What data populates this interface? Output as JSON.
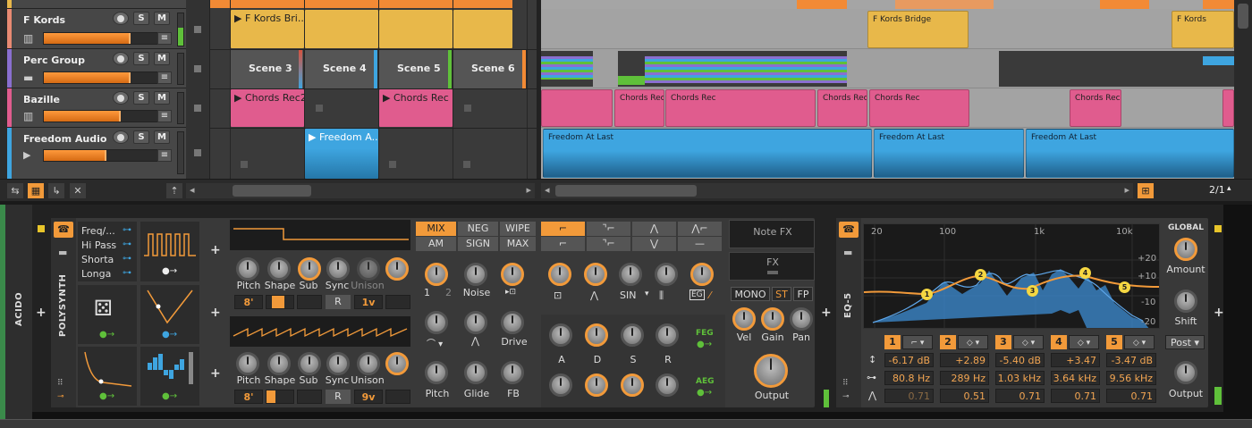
{
  "tracks": [
    {
      "name": "F Kords",
      "color": "#e88a72",
      "icon": "piano-icon"
    },
    {
      "name": "Perc Group",
      "color": "#8a6fd0",
      "icon": "folder-icon"
    },
    {
      "name": "Bazille",
      "color": "#e05c8e",
      "icon": "piano-icon"
    },
    {
      "name": "Freedom Audio",
      "color": "#3ea5e0",
      "icon": "play-icon"
    }
  ],
  "track_buttons": {
    "s": "S",
    "m": "M"
  },
  "launcher_clips": {
    "fkords": [
      "F Kords Bri..."
    ],
    "scenes": [
      "Scene 3",
      "Scene 4",
      "Scene 5",
      "Scene 6"
    ],
    "bazille": [
      "Chords Rec2",
      "Chords Rec"
    ],
    "freedom": [
      "Freedom A..."
    ]
  },
  "arranger_clips": {
    "fkords": [
      "F Kords Bridge",
      "F Kords"
    ],
    "bazille": [
      "Chords Rec",
      "Chords Rec",
      "Chords Rec",
      "Chords Rec",
      "Chords Rec"
    ],
    "freedom": [
      "Freedom At Last",
      "Freedom At Last",
      "Freedom At Last"
    ]
  },
  "arranger_zoom": "2/1",
  "device_strip": {
    "track_label": "ACIDO"
  },
  "polysynth": {
    "title": "POLYSYNTH",
    "mod_list": [
      "Freq/...",
      "Hi Pass",
      "Shorta",
      "Longa"
    ],
    "osc1_knobs": [
      "Pitch",
      "Shape",
      "Sub",
      "Sync",
      "Unison"
    ],
    "osc1_values": [
      "8'",
      "R",
      "1v"
    ],
    "osc2_knobs": [
      "Pitch",
      "Shape",
      "Sub",
      "Sync",
      "Unison"
    ],
    "osc2_values": [
      "8'",
      "R",
      "9v"
    ],
    "mix_modes": [
      "MIX",
      "NEG",
      "WIPE",
      "AM",
      "SIGN",
      "MAX"
    ],
    "mix_labels": [
      "1",
      "2",
      "Noise"
    ],
    "drive_label": "Drive",
    "pitch_labels": [
      "Pitch",
      "Glide",
      "FB"
    ],
    "filter_wave": "SIN",
    "filter_eg": "EG",
    "env_labels": [
      "A",
      "D",
      "S",
      "R"
    ],
    "feg": "FEG",
    "aeg": "AEG",
    "note_fx": "Note FX",
    "fx": "FX",
    "voice_modes": [
      "MONO",
      "ST",
      "FP"
    ],
    "out_labels": [
      "Vel",
      "Gain",
      "Pan"
    ],
    "output": "Output"
  },
  "eq5": {
    "title": "EQ-5",
    "freq_labels": [
      "20",
      "100",
      "1k",
      "10k"
    ],
    "db_labels": [
      "+20",
      "+10",
      "-10",
      "-20"
    ],
    "bands": [
      {
        "num": "1",
        "gain": "-6.17 dB",
        "freq": "80.8 Hz",
        "q": "0.71"
      },
      {
        "num": "2",
        "gain": "+2.89 dB",
        "freq": "289 Hz",
        "q": "0.51"
      },
      {
        "num": "3",
        "gain": "-5.40 dB",
        "freq": "1.03 kHz",
        "q": "0.71"
      },
      {
        "num": "4",
        "gain": "+3.47 dB",
        "freq": "3.64 kHz",
        "q": "0.71"
      },
      {
        "num": "5",
        "gain": "-3.47 dB",
        "freq": "9.56 kHz",
        "q": "0.71"
      }
    ],
    "global": "GLOBAL",
    "amount": "Amount",
    "shift": "Shift",
    "post": "Post",
    "output": "Output"
  },
  "colors": {
    "accent": "#f29a3a",
    "yellow": "#e8b84a",
    "pink": "#e05c8e",
    "blue": "#3ea5e0",
    "purple": "#8a6fd0"
  }
}
